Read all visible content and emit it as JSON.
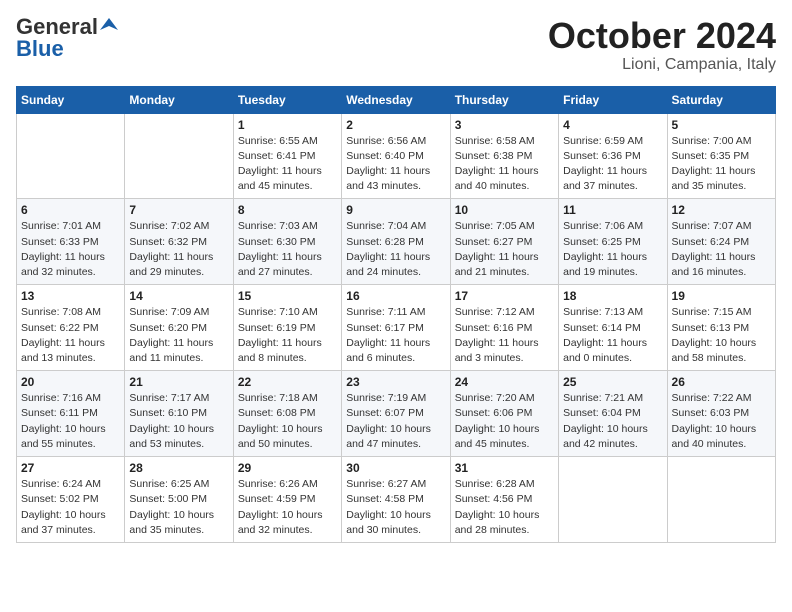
{
  "logo": {
    "general": "General",
    "blue": "Blue"
  },
  "title": "October 2024",
  "location": "Lioni, Campania, Italy",
  "weekdays": [
    "Sunday",
    "Monday",
    "Tuesday",
    "Wednesday",
    "Thursday",
    "Friday",
    "Saturday"
  ],
  "weeks": [
    [
      null,
      null,
      {
        "day": 1,
        "sunrise": "6:55 AM",
        "sunset": "6:41 PM",
        "daylight": "11 hours and 45 minutes."
      },
      {
        "day": 2,
        "sunrise": "6:56 AM",
        "sunset": "6:40 PM",
        "daylight": "11 hours and 43 minutes."
      },
      {
        "day": 3,
        "sunrise": "6:58 AM",
        "sunset": "6:38 PM",
        "daylight": "11 hours and 40 minutes."
      },
      {
        "day": 4,
        "sunrise": "6:59 AM",
        "sunset": "6:36 PM",
        "daylight": "11 hours and 37 minutes."
      },
      {
        "day": 5,
        "sunrise": "7:00 AM",
        "sunset": "6:35 PM",
        "daylight": "11 hours and 35 minutes."
      }
    ],
    [
      {
        "day": 6,
        "sunrise": "7:01 AM",
        "sunset": "6:33 PM",
        "daylight": "11 hours and 32 minutes."
      },
      {
        "day": 7,
        "sunrise": "7:02 AM",
        "sunset": "6:32 PM",
        "daylight": "11 hours and 29 minutes."
      },
      {
        "day": 8,
        "sunrise": "7:03 AM",
        "sunset": "6:30 PM",
        "daylight": "11 hours and 27 minutes."
      },
      {
        "day": 9,
        "sunrise": "7:04 AM",
        "sunset": "6:28 PM",
        "daylight": "11 hours and 24 minutes."
      },
      {
        "day": 10,
        "sunrise": "7:05 AM",
        "sunset": "6:27 PM",
        "daylight": "11 hours and 21 minutes."
      },
      {
        "day": 11,
        "sunrise": "7:06 AM",
        "sunset": "6:25 PM",
        "daylight": "11 hours and 19 minutes."
      },
      {
        "day": 12,
        "sunrise": "7:07 AM",
        "sunset": "6:24 PM",
        "daylight": "11 hours and 16 minutes."
      }
    ],
    [
      {
        "day": 13,
        "sunrise": "7:08 AM",
        "sunset": "6:22 PM",
        "daylight": "11 hours and 13 minutes."
      },
      {
        "day": 14,
        "sunrise": "7:09 AM",
        "sunset": "6:20 PM",
        "daylight": "11 hours and 11 minutes."
      },
      {
        "day": 15,
        "sunrise": "7:10 AM",
        "sunset": "6:19 PM",
        "daylight": "11 hours and 8 minutes."
      },
      {
        "day": 16,
        "sunrise": "7:11 AM",
        "sunset": "6:17 PM",
        "daylight": "11 hours and 6 minutes."
      },
      {
        "day": 17,
        "sunrise": "7:12 AM",
        "sunset": "6:16 PM",
        "daylight": "11 hours and 3 minutes."
      },
      {
        "day": 18,
        "sunrise": "7:13 AM",
        "sunset": "6:14 PM",
        "daylight": "11 hours and 0 minutes."
      },
      {
        "day": 19,
        "sunrise": "7:15 AM",
        "sunset": "6:13 PM",
        "daylight": "10 hours and 58 minutes."
      }
    ],
    [
      {
        "day": 20,
        "sunrise": "7:16 AM",
        "sunset": "6:11 PM",
        "daylight": "10 hours and 55 minutes."
      },
      {
        "day": 21,
        "sunrise": "7:17 AM",
        "sunset": "6:10 PM",
        "daylight": "10 hours and 53 minutes."
      },
      {
        "day": 22,
        "sunrise": "7:18 AM",
        "sunset": "6:08 PM",
        "daylight": "10 hours and 50 minutes."
      },
      {
        "day": 23,
        "sunrise": "7:19 AM",
        "sunset": "6:07 PM",
        "daylight": "10 hours and 47 minutes."
      },
      {
        "day": 24,
        "sunrise": "7:20 AM",
        "sunset": "6:06 PM",
        "daylight": "10 hours and 45 minutes."
      },
      {
        "day": 25,
        "sunrise": "7:21 AM",
        "sunset": "6:04 PM",
        "daylight": "10 hours and 42 minutes."
      },
      {
        "day": 26,
        "sunrise": "7:22 AM",
        "sunset": "6:03 PM",
        "daylight": "10 hours and 40 minutes."
      }
    ],
    [
      {
        "day": 27,
        "sunrise": "6:24 AM",
        "sunset": "5:02 PM",
        "daylight": "10 hours and 37 minutes."
      },
      {
        "day": 28,
        "sunrise": "6:25 AM",
        "sunset": "5:00 PM",
        "daylight": "10 hours and 35 minutes."
      },
      {
        "day": 29,
        "sunrise": "6:26 AM",
        "sunset": "4:59 PM",
        "daylight": "10 hours and 32 minutes."
      },
      {
        "day": 30,
        "sunrise": "6:27 AM",
        "sunset": "4:58 PM",
        "daylight": "10 hours and 30 minutes."
      },
      {
        "day": 31,
        "sunrise": "6:28 AM",
        "sunset": "4:56 PM",
        "daylight": "10 hours and 28 minutes."
      },
      null,
      null
    ]
  ]
}
